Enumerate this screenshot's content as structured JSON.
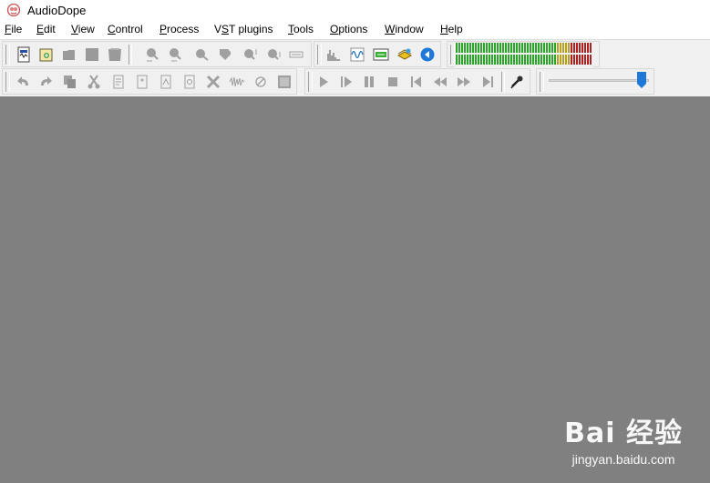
{
  "window": {
    "title": "AudioDope"
  },
  "menu": [
    {
      "label": "File",
      "u": "F",
      "rest": "ile"
    },
    {
      "label": "Edit",
      "u": "E",
      "rest": "dit"
    },
    {
      "label": "View",
      "u": "V",
      "rest": "iew"
    },
    {
      "label": "Control",
      "u": "C",
      "rest": "ontrol"
    },
    {
      "label": "Process",
      "u": "P",
      "rest": "rocess"
    },
    {
      "label": "VST plugins",
      "pre": "V",
      "u": "S",
      "rest": "T plugins"
    },
    {
      "label": "Tools",
      "u": "T",
      "rest": "ools"
    },
    {
      "label": "Options",
      "u": "O",
      "rest": "ptions"
    },
    {
      "label": "Window",
      "u": "W",
      "rest": "indow"
    },
    {
      "label": "Help",
      "u": "H",
      "rest": "elp"
    }
  ],
  "toolbar_row1": {
    "file_buttons": [
      "new-file-icon",
      "open-file-icon",
      "open-folder-icon",
      "save-icon",
      "save-as-icon"
    ],
    "zoom_buttons": [
      "zoom-in-horizontal-icon",
      "zoom-out-horizontal-icon",
      "zoom-in-icon",
      "zoom-out-icon",
      "zoom-in-vertical-icon",
      "zoom-out-vertical-icon",
      "fit-width-icon"
    ],
    "view_buttons": [
      "spectrum-icon",
      "waveform-icon",
      "vst-plugin-icon",
      "batch-process-icon",
      "back-icon"
    ]
  },
  "toolbar_row2": {
    "edit_buttons": [
      "undo-icon",
      "redo-icon",
      "copy-icon",
      "cut-icon",
      "paste-icon",
      "paste-new-icon",
      "mix-paste-icon",
      "paste-special-icon",
      "delete-icon",
      "trim-icon",
      "silence-icon",
      "select-all-icon"
    ],
    "transport_buttons": [
      "play-icon",
      "play-selection-icon",
      "pause-icon",
      "stop-icon",
      "go-to-start-icon",
      "rewind-icon",
      "fast-forward-icon",
      "go-to-end-icon"
    ],
    "record_button": "microphone-icon"
  },
  "volume": {
    "level": 0.93
  },
  "level_meter": {
    "rows": 2,
    "segments": 50,
    "green": 37,
    "yellow": 5,
    "red": 8
  },
  "colors": {
    "workspace": "#808080",
    "meter_green": "#2aa52a",
    "meter_yellow": "#b8a020",
    "meter_red": "#b02020",
    "accent_blue": "#1e78d8"
  },
  "watermark": {
    "brand": "Bai 经验",
    "url": "jingyan.baidu.com"
  }
}
